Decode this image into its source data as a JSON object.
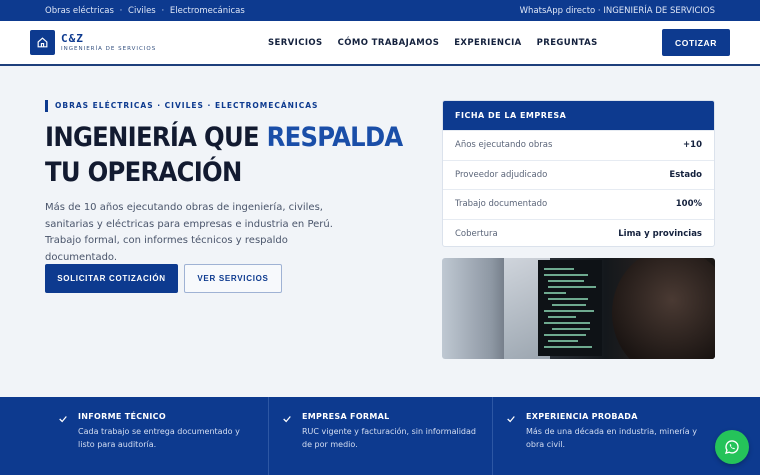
{
  "topbar": {
    "left": [
      "Obras eléctricas",
      "Civiles",
      "Electromecánicas"
    ],
    "separator": "·",
    "right": "WhatsApp directo · INGENIERÍA DE SERVICIOS"
  },
  "brand": {
    "name": "C&Z",
    "tagline": "INGENIERÍA DE SERVICIOS"
  },
  "nav": {
    "items": [
      "SERVICIOS",
      "CÓMO TRABAJAMOS",
      "EXPERIENCIA",
      "PREGUNTAS"
    ],
    "cta": "COTIZAR"
  },
  "hero": {
    "eyebrow": "OBRAS ELÉCTRICAS · CIVILES · ELECTROMECÁNICAS",
    "headline_pre": "INGENIERÍA QUE ",
    "headline_accent": "RESPALDA",
    "headline_post": " TU OPERACIÓN",
    "lede": "Más de 10 años ejecutando obras de ingeniería, civiles, sanitarias y eléctricas para empresas e industria en Perú. Trabajo formal, con informes técnicos y respaldo documentado.",
    "primary_btn": "SOLICITAR COTIZACIÓN",
    "secondary_btn": "VER SERVICIOS"
  },
  "card": {
    "title": "FICHA DE LA EMPRESA",
    "rows": [
      {
        "label": "Años ejecutando obras",
        "value": "+10"
      },
      {
        "label": "Proveedor adjudicado",
        "value": "Estado"
      },
      {
        "label": "Trabajo documentado",
        "value": "100%"
      },
      {
        "label": "Cobertura",
        "value": "Lima y provincias"
      }
    ]
  },
  "features": [
    {
      "title": "INFORME TÉCNICO",
      "desc": "Cada trabajo se entrega documentado y listo para auditoría."
    },
    {
      "title": "EMPRESA FORMAL",
      "desc": "RUC vigente y facturación, sin informalidad de por medio."
    },
    {
      "title": "EXPERIENCIA PROBADA",
      "desc": "Más de una década en industria, minería y obra civil."
    }
  ],
  "colors": {
    "primary": "#0d3a8f",
    "accent": "#1a4ea8",
    "whatsapp": "#25c35a",
    "background": "#f1f4f8"
  },
  "icons": {
    "logo": "home-icon",
    "feature": "check-icon",
    "floating": "whatsapp-icon"
  }
}
